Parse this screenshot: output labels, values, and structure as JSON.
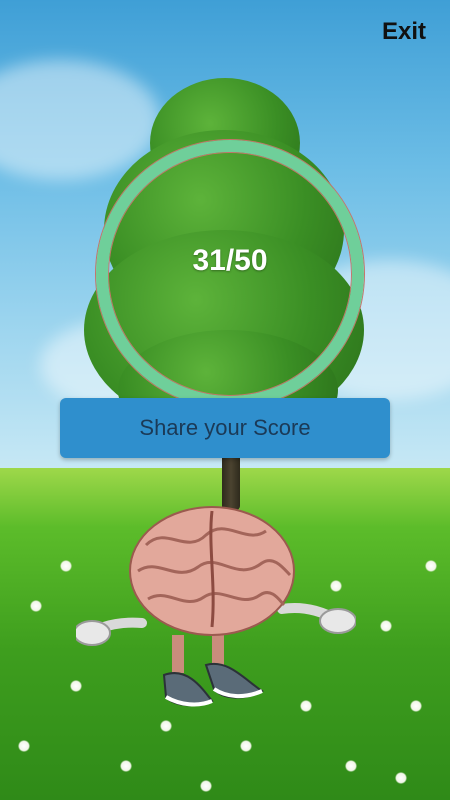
{
  "header": {
    "exit_label": "Exit"
  },
  "score": {
    "correct": 31,
    "total": 50,
    "display": "31/50"
  },
  "share": {
    "label": "Share your Score"
  },
  "mascot": {
    "icon": "brain-character-icon"
  },
  "colors": {
    "ring": "#6fcf9a",
    "share_button": "#2f8fcd",
    "share_text": "#1b3a57",
    "exit_text": "#111111"
  }
}
